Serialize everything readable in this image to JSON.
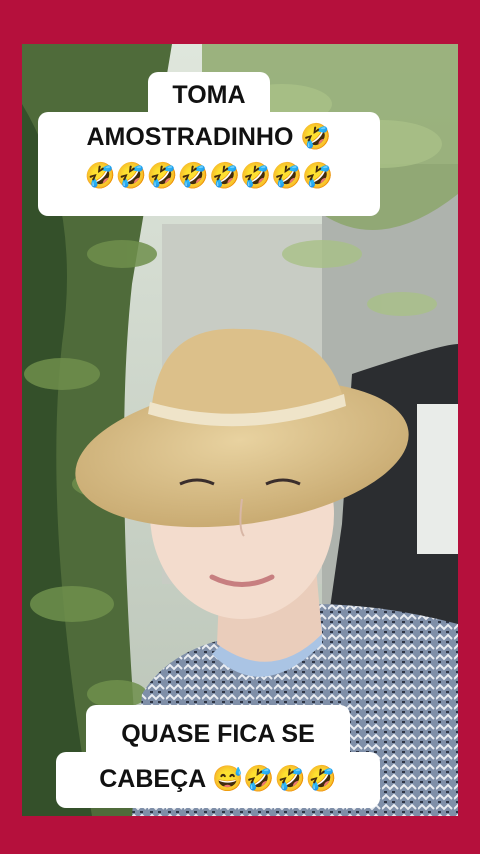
{
  "captions": {
    "top_line1": "TOMA",
    "top_line2": "AMOSTRADINHO 🤣",
    "top_line3": "🤣🤣🤣🤣🤣🤣🤣🤣",
    "bottom_line1": "QUASE FICA SE",
    "bottom_line2": "CABEÇA 😅🤣🤣🤣"
  },
  "colors": {
    "border": "#b5103c",
    "caption_bg": "#ffffff",
    "caption_text": "#111111"
  }
}
